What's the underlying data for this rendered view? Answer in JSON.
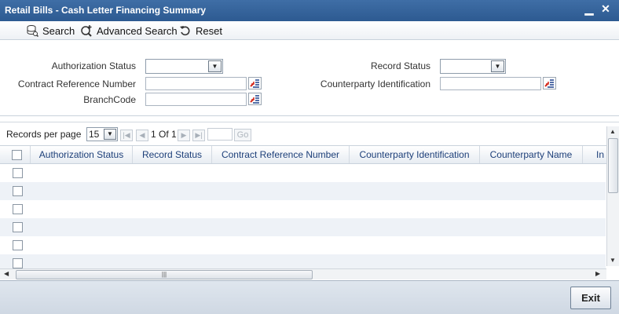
{
  "window": {
    "title": "Retail Bills - Cash Letter Financing Summary",
    "minimize": "▁",
    "close": "✕"
  },
  "toolbar": {
    "search_label": "Search",
    "advanced_search_label": "Advanced Search",
    "reset_label": "Reset"
  },
  "form": {
    "authorization_status_label": "Authorization Status",
    "record_status_label": "Record Status",
    "contract_ref_label": "Contract Reference Number",
    "counterparty_id_label": "Counterparty Identification",
    "branch_code_label": "BranchCode"
  },
  "pager": {
    "records_per_page_label": "Records per page",
    "records_per_page_value": "15",
    "page_info": "1 Of 1",
    "go_label": "Go"
  },
  "grid": {
    "columns": [
      "Authorization Status",
      "Record Status",
      "Contract Reference Number",
      "Counterparty Identification",
      "Counterparty Name",
      "In"
    ]
  },
  "footer": {
    "exit_label": "Exit"
  }
}
